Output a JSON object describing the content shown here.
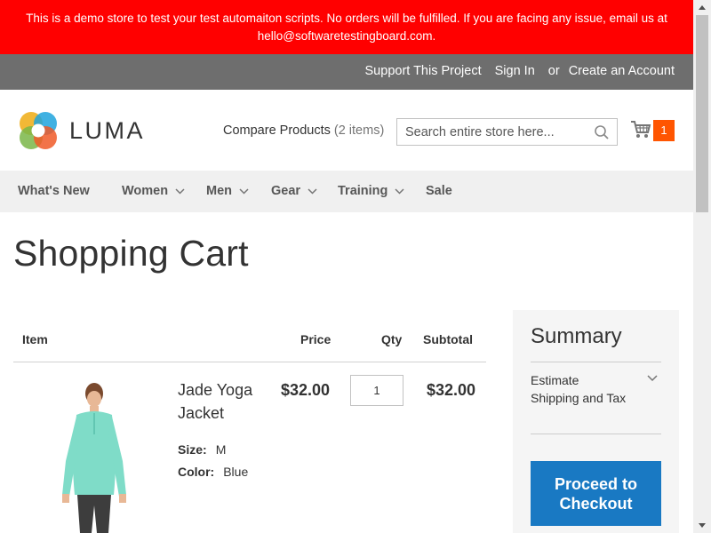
{
  "notice": {
    "text": "This is a demo store to test your test automaiton scripts. No orders will be fulfilled. If you are facing any issue, email us at hello@softwaretestingboard.com."
  },
  "top_links": {
    "support": "Support This Project",
    "sign_in": "Sign In",
    "or": "or",
    "create_account": "Create an Account"
  },
  "header": {
    "logo_text": "LUMA",
    "compare_label": "Compare Products",
    "compare_count": "(2 items)",
    "search_placeholder": "Search entire store here...",
    "cart_count": "1"
  },
  "nav": {
    "items": [
      {
        "label": "What's New",
        "has_dropdown": false
      },
      {
        "label": "Women",
        "has_dropdown": true
      },
      {
        "label": "Men",
        "has_dropdown": true
      },
      {
        "label": "Gear",
        "has_dropdown": true
      },
      {
        "label": "Training",
        "has_dropdown": true
      },
      {
        "label": "Sale",
        "has_dropdown": false
      }
    ]
  },
  "page_title": "Shopping Cart",
  "table": {
    "headers": {
      "item": "Item",
      "price": "Price",
      "qty": "Qty",
      "subtotal": "Subtotal"
    },
    "rows": [
      {
        "name": "Jade Yoga Jacket",
        "options": [
          {
            "label": "Size:",
            "value": "M"
          },
          {
            "label": "Color:",
            "value": "Blue"
          }
        ],
        "price": "$32.00",
        "qty": "1",
        "subtotal": "$32.00"
      }
    ]
  },
  "summary": {
    "title": "Summary",
    "estimate": "Estimate Shipping and Tax",
    "checkout": "Proceed to Checkout"
  },
  "colors": {
    "notice_bg": "#ff0000",
    "topbar_bg": "#6e6e6e",
    "cart_badge": "#ff5501",
    "checkout_bg": "#1979c3",
    "nav_bg": "#f0f0f0"
  }
}
